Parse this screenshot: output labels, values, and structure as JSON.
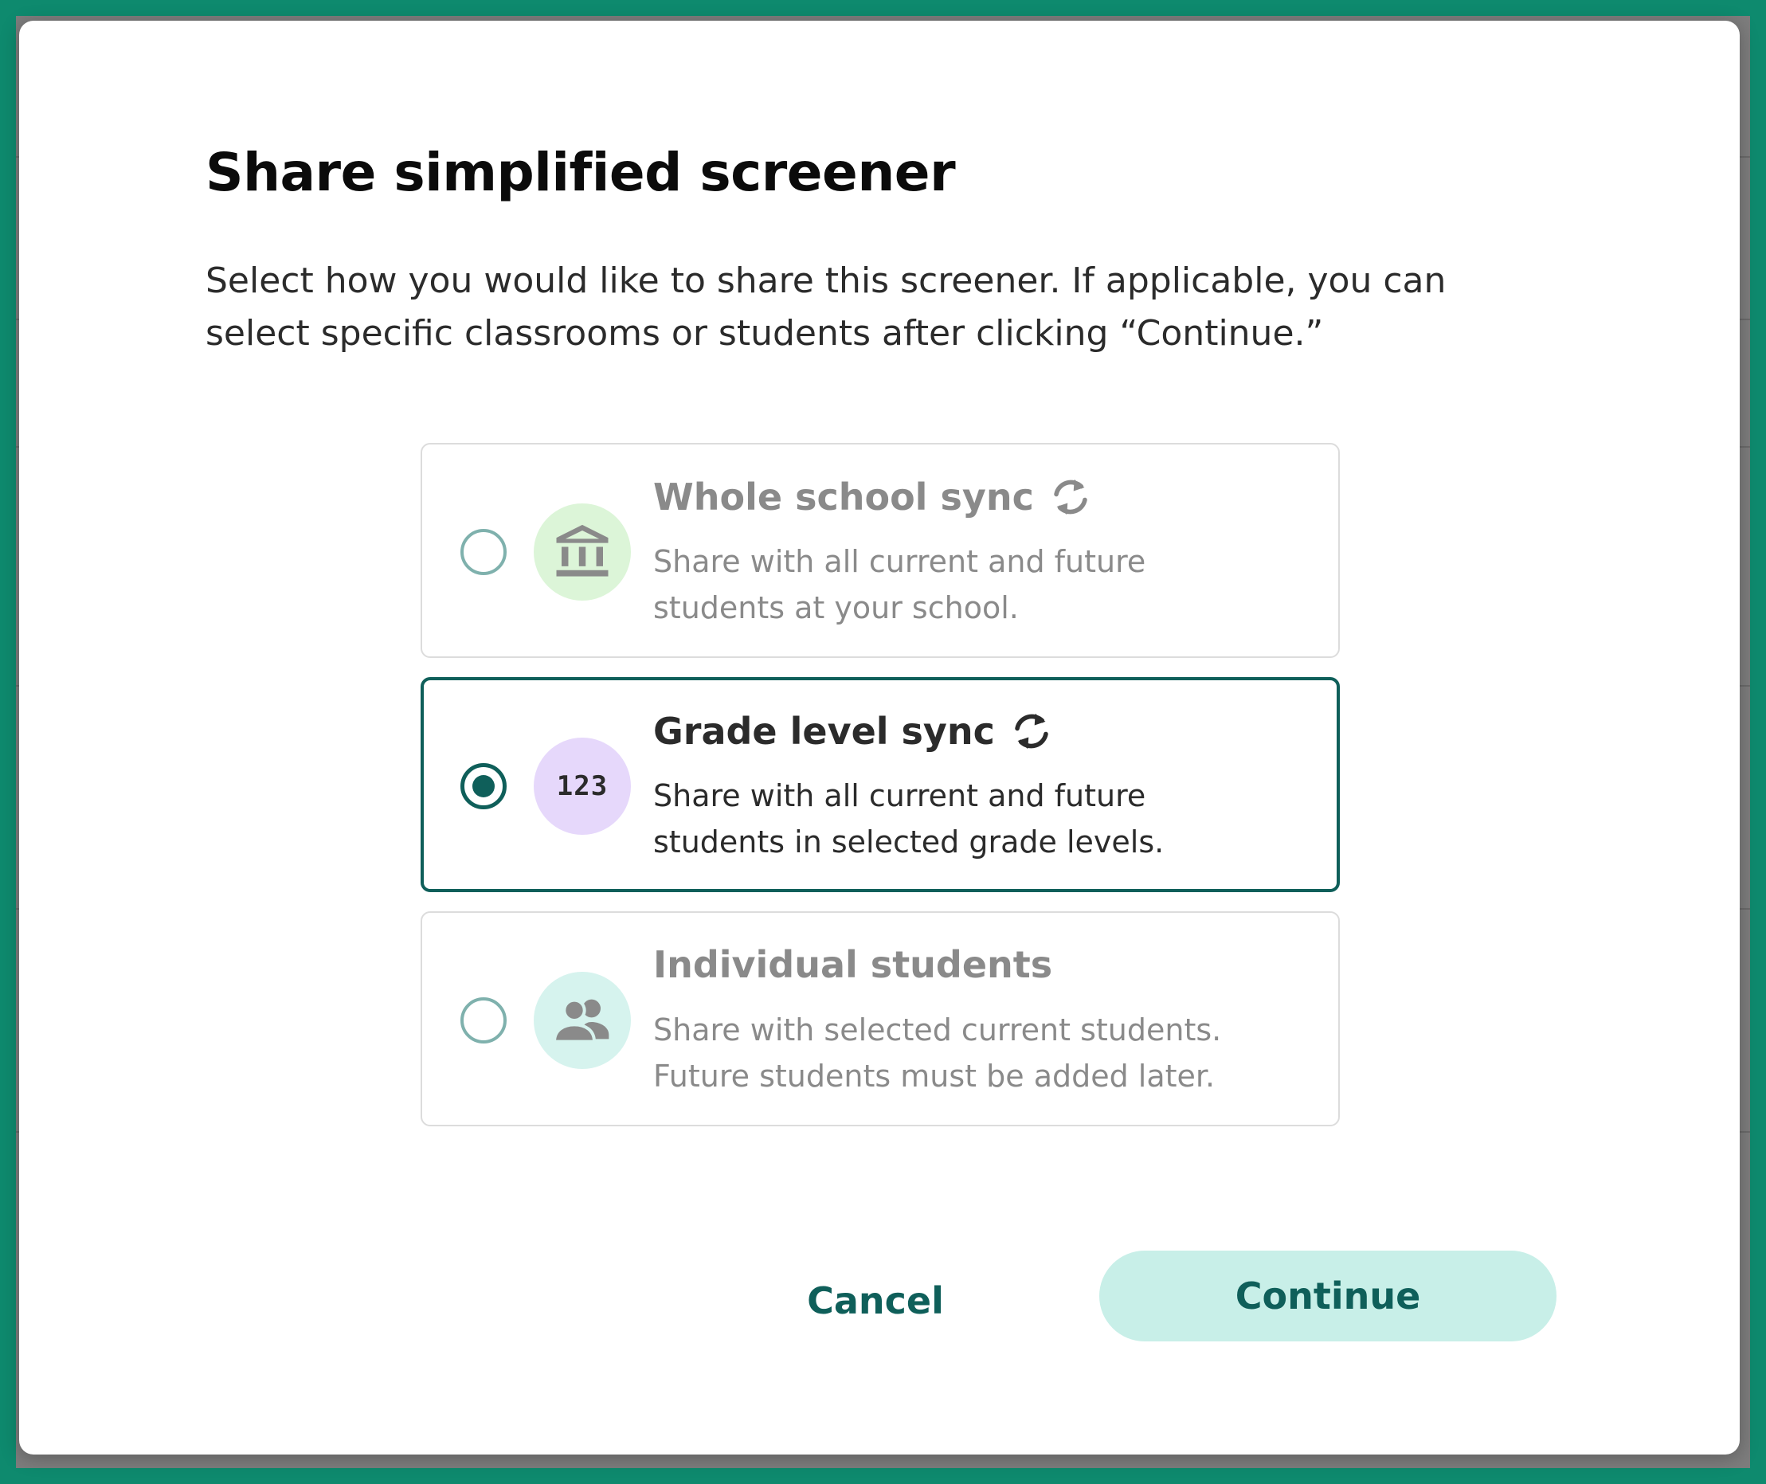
{
  "dialog": {
    "title": "Share simplified screener",
    "description": "Select how you would like to share this screener. If applicable, you can select specific classrooms or students after clicking “Continue.”"
  },
  "options": [
    {
      "title": "Whole school sync",
      "description": "Share with all current and future students at your school.",
      "icon": "school-building-icon",
      "icon_bg": "#dcf5d8",
      "sync": true,
      "selected": false
    },
    {
      "title": "Grade level sync",
      "description": "Share with all current and future students in selected grade levels.",
      "icon": "numbers-icon",
      "icon_text": "123",
      "icon_bg": "#e6d8fb",
      "sync": true,
      "selected": true
    },
    {
      "title": "Individual students",
      "description": "Share with selected current students. Future students must be added later.",
      "icon": "users-icon",
      "icon_bg": "#d6f3ee",
      "sync": false,
      "selected": false
    }
  ],
  "actions": {
    "cancel_label": "Cancel",
    "continue_label": "Continue"
  },
  "colors": {
    "accent": "#0f5f5a",
    "continue_bg": "#c8efe8",
    "frame": "#0e8a6e"
  }
}
